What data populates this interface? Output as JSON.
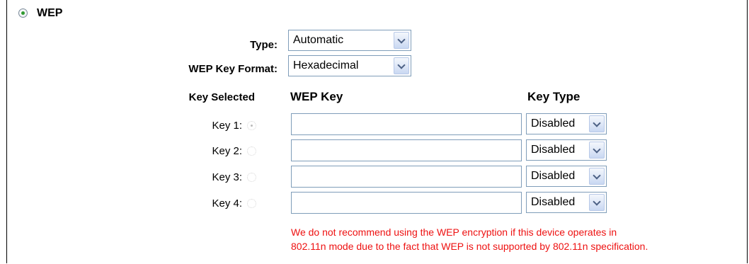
{
  "section": {
    "title": "WEP"
  },
  "type_field": {
    "label": "Type:",
    "value": "Automatic"
  },
  "format_field": {
    "label": "WEP Key Format:",
    "value": "Hexadecimal"
  },
  "headers": {
    "key_selected": "Key Selected",
    "wep_key": "WEP Key",
    "key_type": "Key Type"
  },
  "keys": [
    {
      "label": "Key 1:",
      "value": "",
      "type": "Disabled",
      "selected": true
    },
    {
      "label": "Key 2:",
      "value": "",
      "type": "Disabled",
      "selected": false
    },
    {
      "label": "Key 3:",
      "value": "",
      "type": "Disabled",
      "selected": false
    },
    {
      "label": "Key 4:",
      "value": "",
      "type": "Disabled",
      "selected": false
    }
  ],
  "warning": {
    "line1": "We do not recommend using the WEP encryption if this device operates in",
    "line2": "802.11n mode due to the fact that WEP is not supported by 802.11n specification."
  },
  "colors": {
    "warning": "#ee1111",
    "radio_active": "#2f9a2f",
    "field_border": "#7f9db9"
  }
}
